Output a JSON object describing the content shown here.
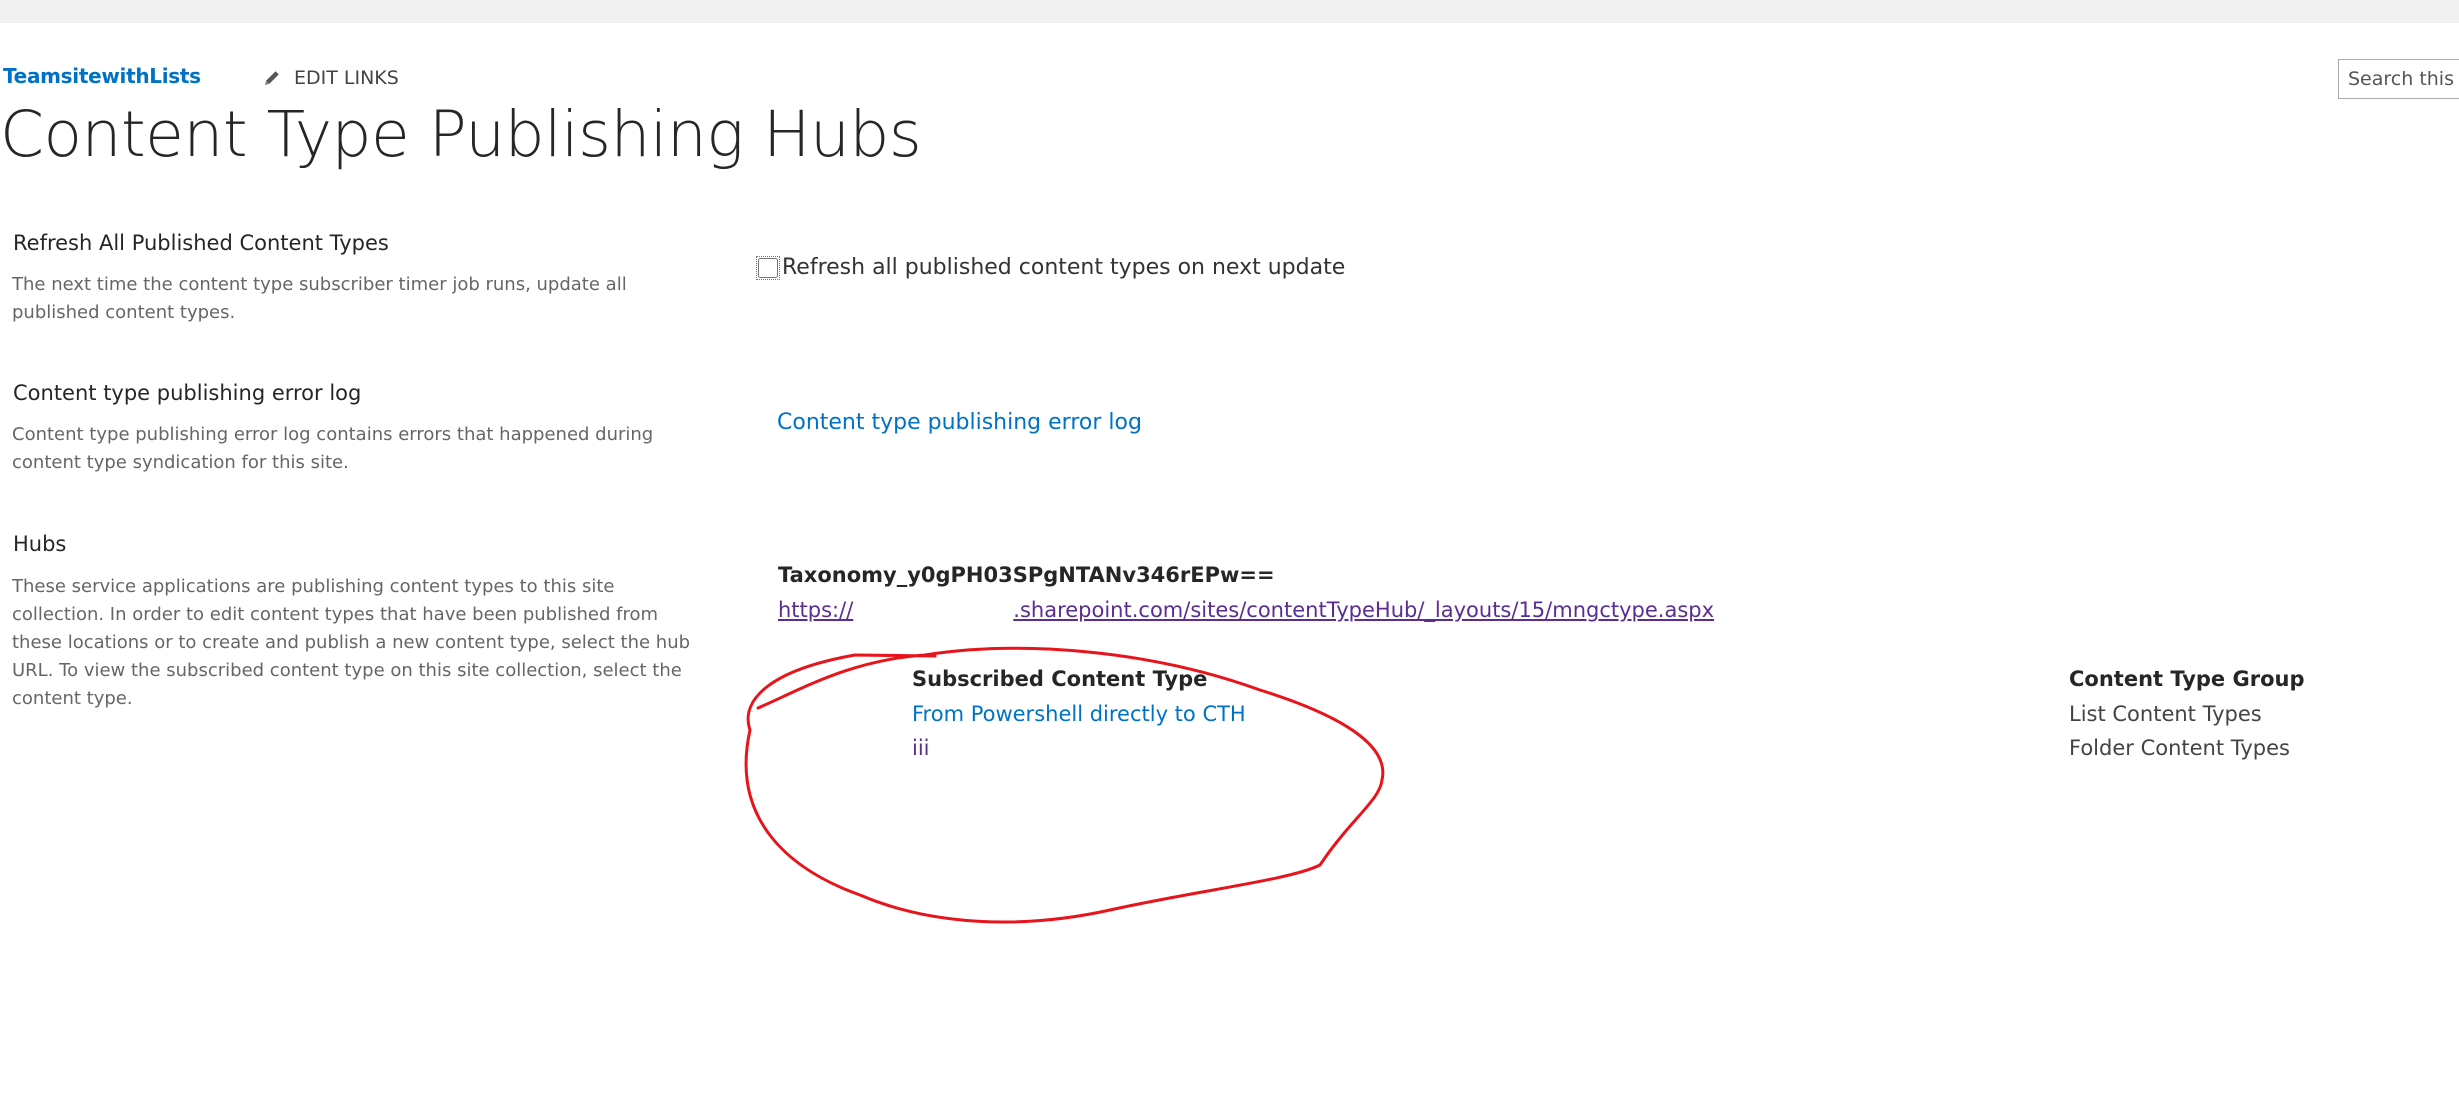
{
  "header": {
    "site_name": "TeamsitewithLists",
    "edit_links": "EDIT LINKS",
    "search_placeholder": "Search this s",
    "page_title": "Content Type Publishing Hubs"
  },
  "sections": {
    "refresh": {
      "title": "Refresh All Published Content Types",
      "description": "The next time the content type subscriber timer job runs, update all published content types.",
      "checkbox_label": "Refresh all published content types on next update",
      "checked": false
    },
    "error_log": {
      "title": "Content type publishing error log",
      "description": "Content type publishing error log contains errors that happened during content type syndication for this site.",
      "link_text": "Content type publishing error log"
    },
    "hubs": {
      "title": "Hubs",
      "description": "These service applications are publishing content types to this site collection.  In order to edit content types that have been published from these locations or to create and publish a new content type, select the hub URL.  To view the subscribed content type on this site collection, select the content type.",
      "hub_name": "Taxonomy_y0gPH03SPgNTANv346rEPw==",
      "hub_url_prefix": "https://",
      "hub_url_suffix": ".sharepoint.com/sites/contentTypeHub/_layouts/15/mngctype.aspx",
      "table": {
        "columns": [
          "Subscribed Content Type",
          "Content Type Group"
        ],
        "rows": [
          {
            "content_type": "From Powershell directly to CTH",
            "group": "List Content Types"
          },
          {
            "content_type": "iii",
            "group": "Folder Content Types"
          }
        ]
      }
    }
  },
  "colors": {
    "link": "#0072c6",
    "visited_link": "#5a2d91",
    "annotation": "#e8141b"
  },
  "icons": {
    "edit_links": "pencil-icon"
  }
}
